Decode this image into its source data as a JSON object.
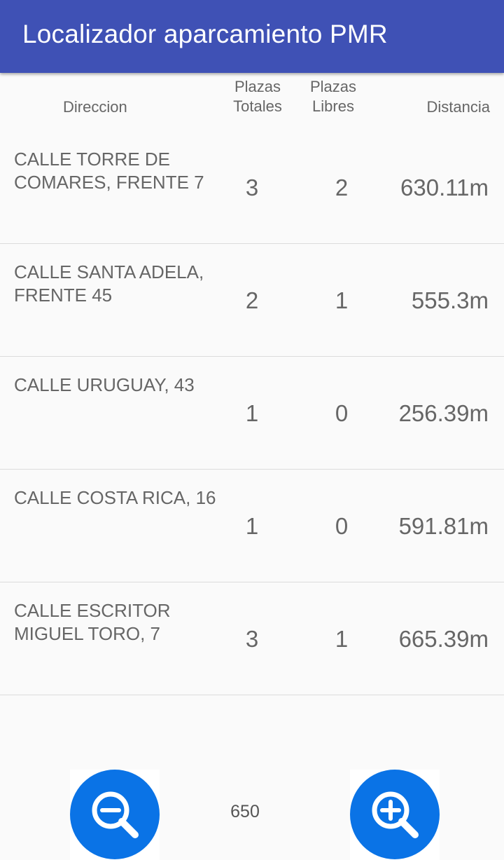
{
  "app": {
    "title": "Localizador aparcamiento PMR",
    "accent_color": "#3f51b5",
    "button_color": "#0a73e6"
  },
  "table": {
    "headers": {
      "direccion": "Direccion",
      "plazas_totales": "Plazas Totales",
      "plazas_libres": "Plazas Libres",
      "distancia": "Distancia"
    },
    "rows": [
      {
        "direccion": "CALLE TORRE DE COMARES, FRENTE 7",
        "totales": "3",
        "libres": "2",
        "distancia": "630.11m"
      },
      {
        "direccion": "CALLE SANTA ADELA, FRENTE 45",
        "totales": "2",
        "libres": "1",
        "distancia": "555.3m"
      },
      {
        "direccion": "CALLE URUGUAY, 43",
        "totales": "1",
        "libres": "0",
        "distancia": "256.39m"
      },
      {
        "direccion": "CALLE COSTA RICA, 16",
        "totales": "1",
        "libres": "0",
        "distancia": "591.81m"
      },
      {
        "direccion": "CALLE ESCRITOR MIGUEL TORO, 7",
        "totales": "3",
        "libres": "1",
        "distancia": "665.39m"
      }
    ]
  },
  "controls": {
    "zoom_out_icon": "zoom-out-icon",
    "zoom_in_icon": "zoom-in-icon",
    "radius_value": "650"
  }
}
